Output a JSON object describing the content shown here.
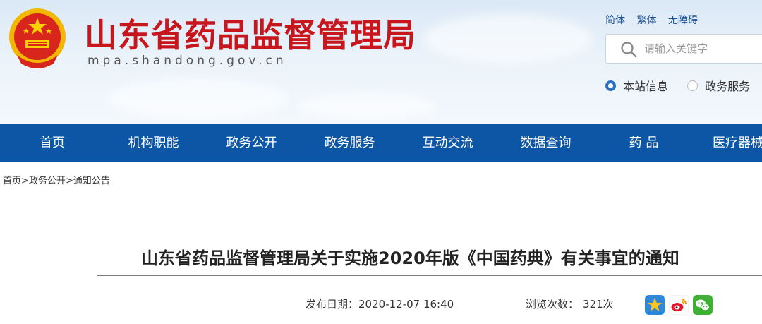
{
  "header": {
    "site_title": "山东省药品监督管理局",
    "site_domain": "mpa.shandong.gov.cn",
    "lang_links": [
      "简体",
      "繁体",
      "无障碍"
    ],
    "search": {
      "placeholder": "请输入关键字",
      "value": ""
    },
    "scope_options": [
      {
        "label": "本站信息",
        "selected": true
      },
      {
        "label": "政务服务",
        "selected": false
      }
    ]
  },
  "nav": {
    "items": [
      "首页",
      "机构职能",
      "政务公开",
      "政务服务",
      "互动交流",
      "数据查询",
      "药 品",
      "医疗器械"
    ]
  },
  "breadcrumb": {
    "items": [
      "首页",
      "政务公开",
      "通知公告"
    ],
    "separator": ">"
  },
  "article": {
    "title": "山东省药品监督管理局关于实施2020年版《中国药典》有关事宜的通知",
    "publish_label": "发布日期：",
    "publish_date": "2020-12-07 16:40",
    "views_label": "浏览次数：",
    "views": "321次"
  },
  "share": {
    "icons": [
      "qzone-star-icon",
      "weibo-icon",
      "wechat-icon"
    ]
  },
  "colors": {
    "nav_bg": "#0d56a6",
    "title_red": "#c8161d",
    "link_blue": "#1a4f8e",
    "radio_blue": "#2b6fc2"
  }
}
